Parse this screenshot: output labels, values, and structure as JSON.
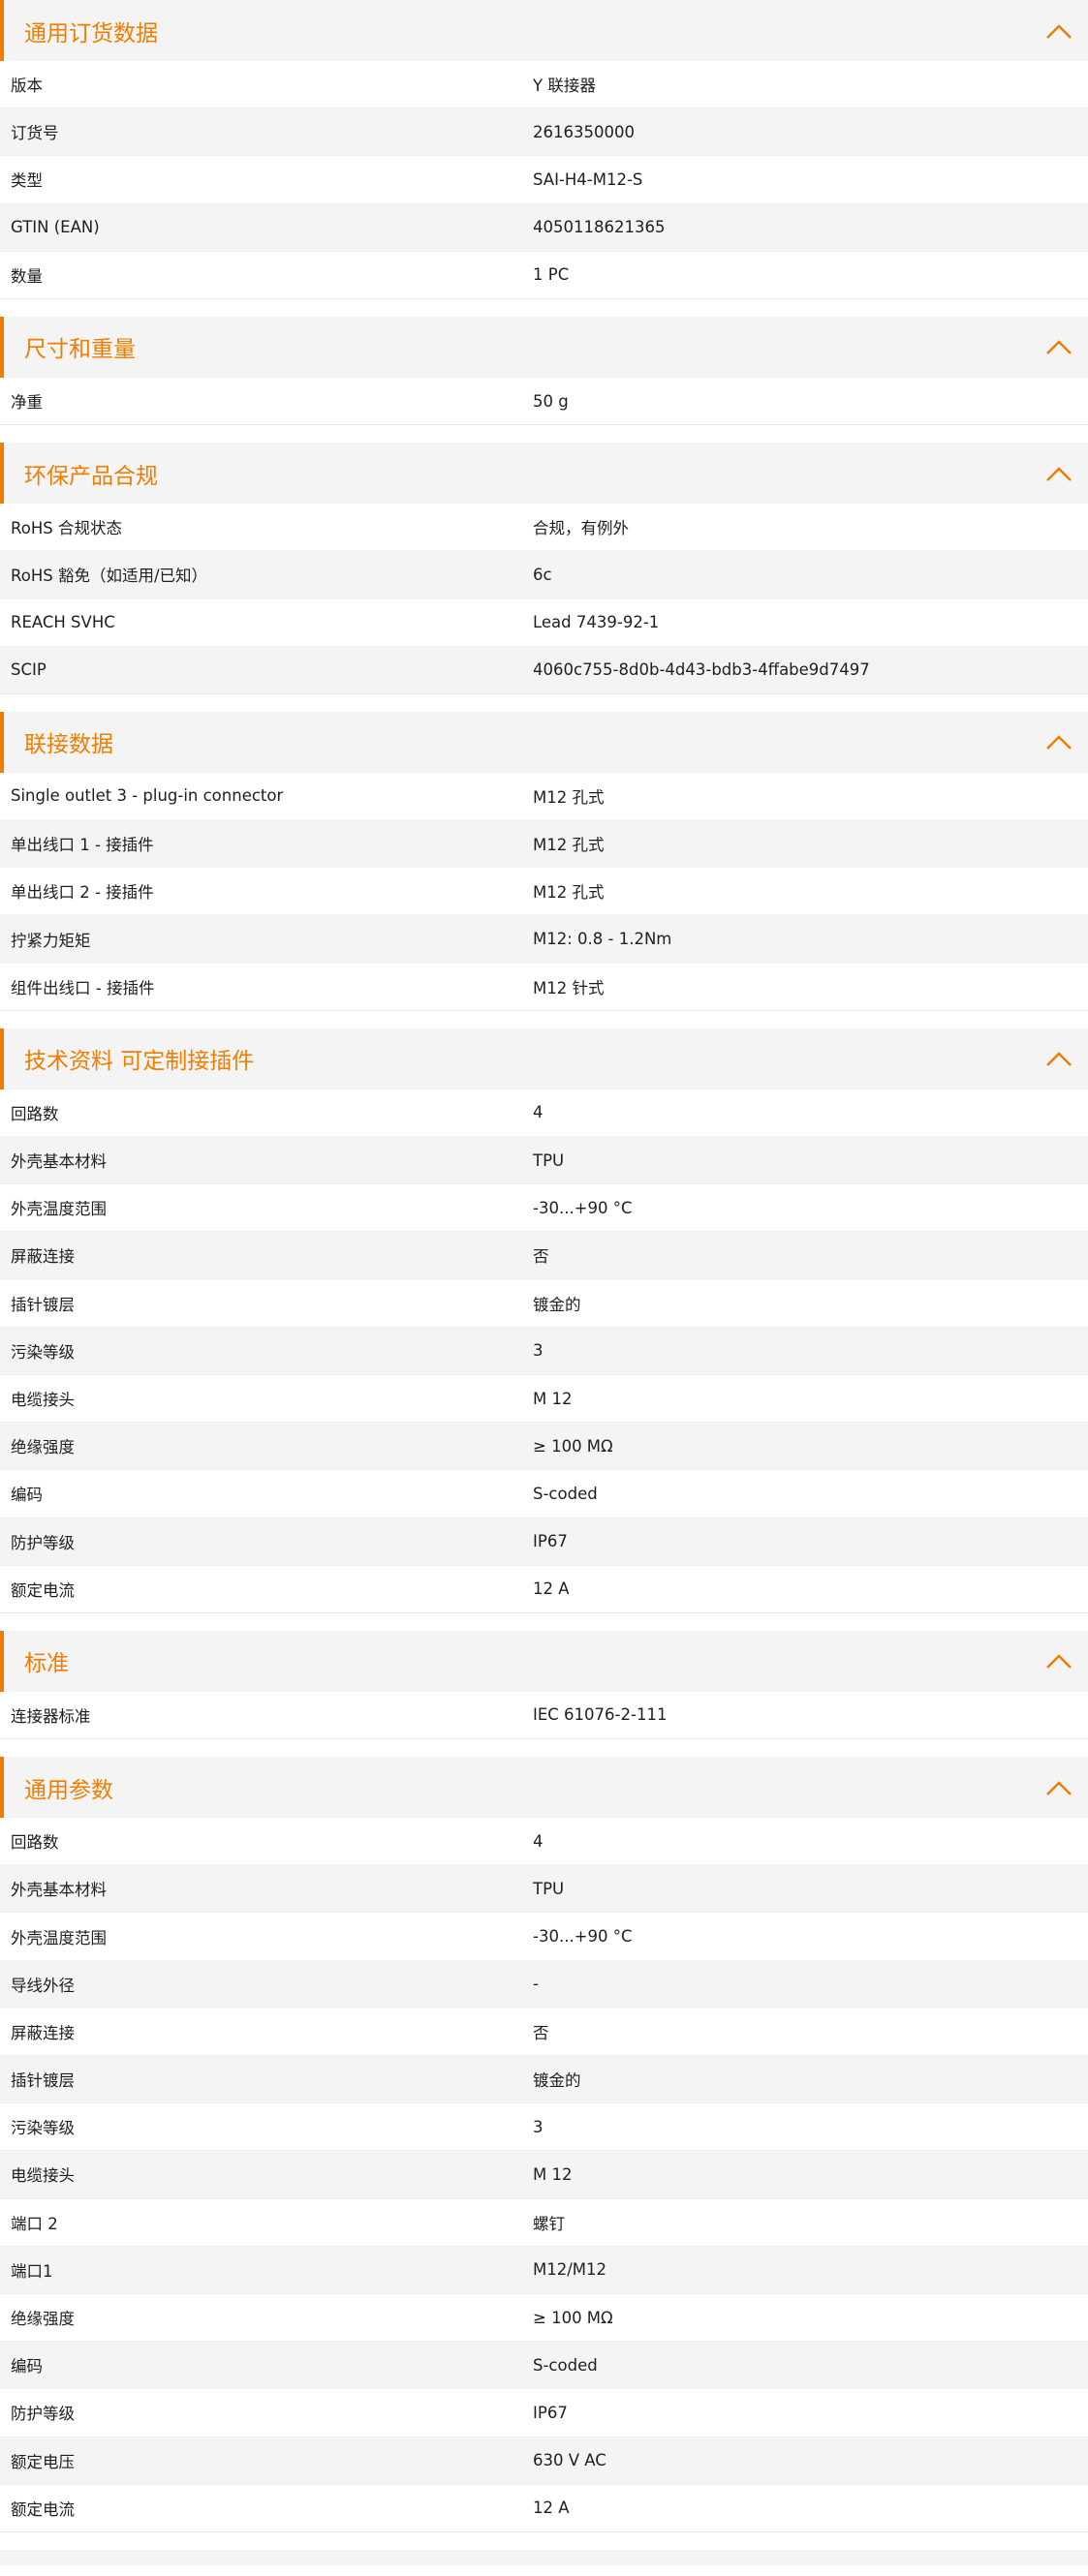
{
  "accent_color": "#f07d00",
  "icons": {
    "section_toggle": "chevron-up-icon"
  },
  "sections": [
    {
      "title": "通用订货数据",
      "rows": [
        {
          "label": "版本",
          "value": "Y 联接器"
        },
        {
          "label": "订货号",
          "value": "2616350000"
        },
        {
          "label": "类型",
          "value": "SAI-H4-M12-S"
        },
        {
          "label": "GTIN (EAN)",
          "value": "4050118621365"
        },
        {
          "label": "数量",
          "value": "1  PC"
        }
      ]
    },
    {
      "title": "尺寸和重量",
      "rows": [
        {
          "label": "净重",
          "value": "50  g"
        }
      ]
    },
    {
      "title": "环保产品合规",
      "rows": [
        {
          "label": "RoHS 合规状态",
          "value": "合规，有例外"
        },
        {
          "label": "RoHS 豁免（如适用/已知）",
          "value": "6c"
        },
        {
          "label": "REACH SVHC",
          "value": "Lead 7439-92-1"
        },
        {
          "label": "SCIP",
          "value": "4060c755-8d0b-4d43-bdb3-4ffabe9d7497"
        }
      ]
    },
    {
      "title": "联接数据",
      "rows": [
        {
          "label": "Single outlet 3 - plug-in connector",
          "value": "M12 孔式"
        },
        {
          "label": "单出线口 1 - 接插件",
          "value": "M12 孔式"
        },
        {
          "label": "单出线口 2 - 接插件",
          "value": "M12 孔式"
        },
        {
          "label": "拧紧力矩矩",
          "value": "M12: 0.8 - 1.2Nm"
        },
        {
          "label": "组件出线口 - 接插件",
          "value": "M12 针式"
        }
      ]
    },
    {
      "title": "技术资料 可定制接插件",
      "rows": [
        {
          "label": "回路数",
          "value": "4"
        },
        {
          "label": "外壳基本材料",
          "value": "TPU"
        },
        {
          "label": "外壳温度范围",
          "value": "-30...+90 °C"
        },
        {
          "label": "屏蔽连接",
          "value": "否"
        },
        {
          "label": "插针镀层",
          "value": "镀金的"
        },
        {
          "label": "污染等级",
          "value": "3"
        },
        {
          "label": "电缆接头",
          "value": "M 12"
        },
        {
          "label": "绝缘强度",
          "value": "≥ 100 MΩ"
        },
        {
          "label": "编码",
          "value": "S-coded"
        },
        {
          "label": "防护等级",
          "value": "IP67"
        },
        {
          "label": "额定电流",
          "value": "12  A"
        }
      ]
    },
    {
      "title": "标准",
      "rows": [
        {
          "label": "连接器标准",
          "value": "IEC 61076-2-111"
        }
      ]
    },
    {
      "title": "通用参数",
      "rows": [
        {
          "label": "回路数",
          "value": "4"
        },
        {
          "label": "外壳基本材料",
          "value": "TPU"
        },
        {
          "label": "外壳温度范围",
          "value": "-30...+90 °C"
        },
        {
          "label": "导线外径",
          "value": "-"
        },
        {
          "label": "屏蔽连接",
          "value": "否"
        },
        {
          "label": "插针镀层",
          "value": "镀金的"
        },
        {
          "label": "污染等级",
          "value": "3"
        },
        {
          "label": "电缆接头",
          "value": "M 12"
        },
        {
          "label": "端口 2",
          "value": "螺钉"
        },
        {
          "label": "端口1",
          "value": "M12/M12"
        },
        {
          "label": "绝缘强度",
          "value": "≥ 100 MΩ"
        },
        {
          "label": "编码",
          "value": "S-coded"
        },
        {
          "label": "防护等级",
          "value": "IP67"
        },
        {
          "label": "额定电压",
          "value": "630 V AC"
        },
        {
          "label": "额定电流",
          "value": "12  A"
        }
      ]
    }
  ]
}
